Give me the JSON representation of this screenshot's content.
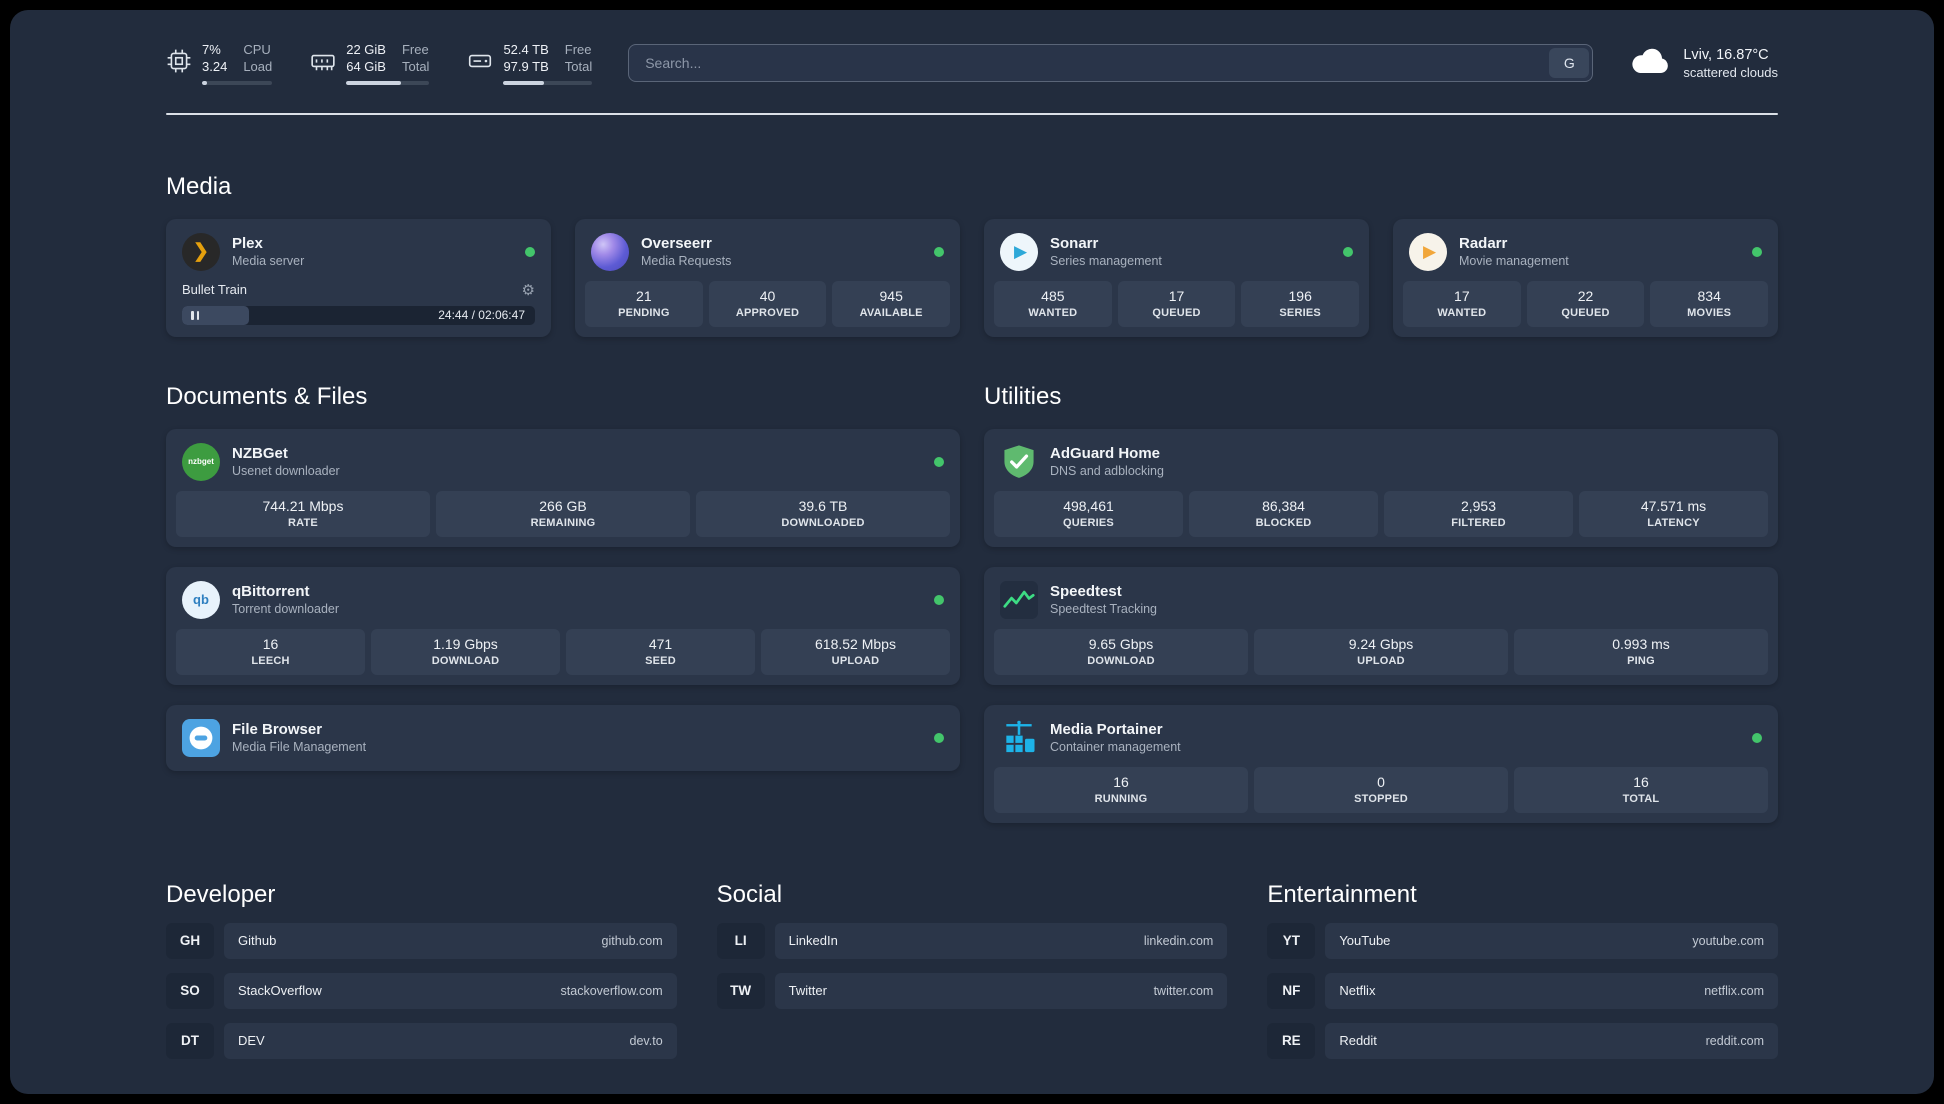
{
  "topbar": {
    "metrics": [
      {
        "value1": "7%",
        "value2": "3.24",
        "label1": "CPU",
        "label2": "Load",
        "progress": 7
      },
      {
        "value1": "22 GiB",
        "value2": "64 GiB",
        "label1": "Free",
        "label2": "Total",
        "progress": 66
      },
      {
        "value1": "52.4 TB",
        "value2": "97.9 TB",
        "label1": "Free",
        "label2": "Total",
        "progress": 46
      }
    ],
    "search": {
      "placeholder": "Search...",
      "provider": "G"
    },
    "weather": {
      "location": "Lviv, 16.87°C",
      "condition": "scattered clouds"
    }
  },
  "sections": {
    "media": "Media",
    "documents": "Documents & Files",
    "utilities": "Utilities",
    "developer": "Developer",
    "social": "Social",
    "entertainment": "Entertainment"
  },
  "glyphs": {
    "plex": "❯",
    "gear": "⚙",
    "nzbget": "nzbget",
    "qb": "qb",
    "sonarr_play": "▶",
    "radarr_play": "▶"
  },
  "colors": {
    "status_green": "#43c56b",
    "plex_amber": "#e5a00d",
    "portainer_blue": "#1db3e8",
    "adguard_green": "#5fba6f"
  },
  "services": {
    "plex": {
      "title": "Plex",
      "subtitle": "Media server",
      "now_playing": "Bullet Train",
      "time": "24:44 / 02:06:47",
      "progress": 19
    },
    "overseerr": {
      "title": "Overseerr",
      "subtitle": "Media Requests",
      "stats": [
        {
          "value": "21",
          "label": "PENDING"
        },
        {
          "value": "40",
          "label": "APPROVED"
        },
        {
          "value": "945",
          "label": "AVAILABLE"
        }
      ]
    },
    "sonarr": {
      "title": "Sonarr",
      "subtitle": "Series management",
      "stats": [
        {
          "value": "485",
          "label": "WANTED"
        },
        {
          "value": "17",
          "label": "QUEUED"
        },
        {
          "value": "196",
          "label": "SERIES"
        }
      ]
    },
    "radarr": {
      "title": "Radarr",
      "subtitle": "Movie management",
      "stats": [
        {
          "value": "17",
          "label": "WANTED"
        },
        {
          "value": "22",
          "label": "QUEUED"
        },
        {
          "value": "834",
          "label": "MOVIES"
        }
      ]
    },
    "nzbget": {
      "title": "NZBGet",
      "subtitle": "Usenet downloader",
      "stats": [
        {
          "value": "744.21 Mbps",
          "label": "RATE"
        },
        {
          "value": "266 GB",
          "label": "REMAINING"
        },
        {
          "value": "39.6 TB",
          "label": "DOWNLOADED"
        }
      ]
    },
    "qbittorrent": {
      "title": "qBittorrent",
      "subtitle": "Torrent downloader",
      "stats": [
        {
          "value": "16",
          "label": "LEECH"
        },
        {
          "value": "1.19 Gbps",
          "label": "DOWNLOAD"
        },
        {
          "value": "471",
          "label": "SEED"
        },
        {
          "value": "618.52 Mbps",
          "label": "UPLOAD"
        }
      ]
    },
    "filebrowser": {
      "title": "File Browser",
      "subtitle": "Media File Management"
    },
    "adguard": {
      "title": "AdGuard Home",
      "subtitle": "DNS and adblocking",
      "stats": [
        {
          "value": "498,461",
          "label": "QUERIES"
        },
        {
          "value": "86,384",
          "label": "BLOCKED"
        },
        {
          "value": "2,953",
          "label": "FILTERED"
        },
        {
          "value": "47.571 ms",
          "label": "LATENCY"
        }
      ]
    },
    "speedtest": {
      "title": "Speedtest",
      "subtitle": "Speedtest Tracking",
      "stats": [
        {
          "value": "9.65 Gbps",
          "label": "DOWNLOAD"
        },
        {
          "value": "9.24 Gbps",
          "label": "UPLOAD"
        },
        {
          "value": "0.993 ms",
          "label": "PING"
        }
      ]
    },
    "portainer": {
      "title": "Media Portainer",
      "subtitle": "Container management",
      "stats": [
        {
          "value": "16",
          "label": "RUNNING"
        },
        {
          "value": "0",
          "label": "STOPPED"
        },
        {
          "value": "16",
          "label": "TOTAL"
        }
      ]
    }
  },
  "links": {
    "developer": [
      {
        "abbr": "GH",
        "name": "Github",
        "url": "github.com"
      },
      {
        "abbr": "SO",
        "name": "StackOverflow",
        "url": "stackoverflow.com"
      },
      {
        "abbr": "DT",
        "name": "DEV",
        "url": "dev.to"
      }
    ],
    "social": [
      {
        "abbr": "LI",
        "name": "LinkedIn",
        "url": "linkedin.com"
      },
      {
        "abbr": "TW",
        "name": "Twitter",
        "url": "twitter.com"
      }
    ],
    "entertainment": [
      {
        "abbr": "YT",
        "name": "YouTube",
        "url": "youtube.com"
      },
      {
        "abbr": "NF",
        "name": "Netflix",
        "url": "netflix.com"
      },
      {
        "abbr": "RE",
        "name": "Reddit",
        "url": "reddit.com"
      }
    ]
  }
}
